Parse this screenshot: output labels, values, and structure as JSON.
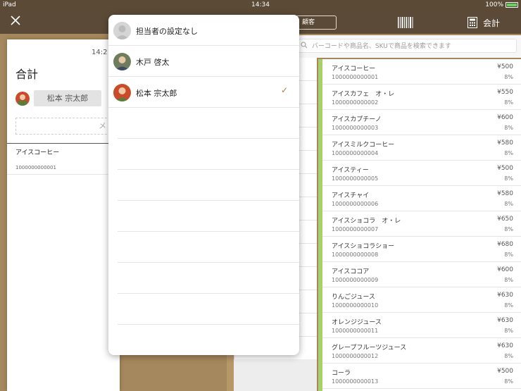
{
  "status_bar": {
    "device": "iPad",
    "time": "14:34",
    "battery": "100%"
  },
  "navbar": {
    "customer_label": "顧客",
    "checkout_label": "会計"
  },
  "receipt": {
    "time": "14:2",
    "title": "合計",
    "staff_name": "松本 宗太郎",
    "memo_placeholder": "メ",
    "items": [
      {
        "name": "アイスコーヒー",
        "sku": "1000000000001"
      }
    ]
  },
  "search": {
    "placeholder": "バーコードや商品名、SKUで商品を検索できます"
  },
  "staff_popover": {
    "options": [
      {
        "label": "担当者の設定なし",
        "selected": false
      },
      {
        "label": "木戸 啓太",
        "selected": false
      },
      {
        "label": "松本 宗太郎",
        "selected": true
      }
    ],
    "check_mark": "✓"
  },
  "products": [
    {
      "name": "アイスコーヒー",
      "sku": "1000000000001",
      "price": "¥500",
      "tax": "8%"
    },
    {
      "name": "アイスカフェ　オ・レ",
      "sku": "1000000000002",
      "price": "¥550",
      "tax": "8%"
    },
    {
      "name": "アイスカプチーノ",
      "sku": "1000000000003",
      "price": "¥600",
      "tax": "8%"
    },
    {
      "name": "アイスミルクコーヒー",
      "sku": "1000000000004",
      "price": "¥580",
      "tax": "8%"
    },
    {
      "name": "アイスティー",
      "sku": "1000000000005",
      "price": "¥500",
      "tax": "8%"
    },
    {
      "name": "アイスチャイ",
      "sku": "1000000000006",
      "price": "¥580",
      "tax": "8%"
    },
    {
      "name": "アイスショコラ　オ・レ",
      "sku": "1000000000007",
      "price": "¥650",
      "tax": "8%"
    },
    {
      "name": "アイスショコラショー",
      "sku": "1000000000008",
      "price": "¥680",
      "tax": "8%"
    },
    {
      "name": "アイスココア",
      "sku": "1000000000009",
      "price": "¥600",
      "tax": "8%"
    },
    {
      "name": "りんごジュース",
      "sku": "1000000000010",
      "price": "¥630",
      "tax": "8%"
    },
    {
      "name": "オレンジジュース",
      "sku": "1000000000011",
      "price": "¥630",
      "tax": "8%"
    },
    {
      "name": "グレープフルーツジュース",
      "sku": "1000000000012",
      "price": "¥630",
      "tax": "8%"
    },
    {
      "name": "コーラ",
      "sku": "1000000000013",
      "price": "¥500",
      "tax": "8%"
    }
  ],
  "colors": {
    "navbar": "#5b4a37",
    "wood": "#a5885d",
    "accent_green": "#a8cf6a",
    "check": "#b07a3c"
  }
}
